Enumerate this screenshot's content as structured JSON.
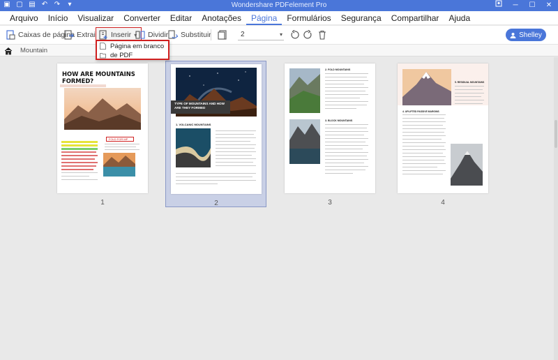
{
  "app": {
    "title": "Wondershare PDFelement Pro",
    "accent": "#4a76d9",
    "highlight": "#d02020"
  },
  "quick_access": [
    {
      "icon": "folder-icon",
      "glyph": "▣"
    },
    {
      "icon": "save-icon",
      "glyph": "▢"
    },
    {
      "icon": "print-icon",
      "glyph": "▤"
    },
    {
      "icon": "undo-icon",
      "glyph": "↶"
    },
    {
      "icon": "redo-icon",
      "glyph": "↷"
    },
    {
      "icon": "dropdown-icon",
      "glyph": "▾"
    }
  ],
  "menu": [
    {
      "label": "Arquivo",
      "active": false
    },
    {
      "label": "Início",
      "active": false
    },
    {
      "label": "Visualizar",
      "active": false
    },
    {
      "label": "Converter",
      "active": false
    },
    {
      "label": "Editar",
      "active": false
    },
    {
      "label": "Anotações",
      "active": false
    },
    {
      "label": "Página",
      "active": true
    },
    {
      "label": "Formulários",
      "active": false
    },
    {
      "label": "Segurança",
      "active": false
    },
    {
      "label": "Compartilhar",
      "active": false
    },
    {
      "label": "Ajuda",
      "active": false
    }
  ],
  "toolbar": {
    "page_boxes": "Caixas de página",
    "extract": "Extrair",
    "insert": "Inserir",
    "split": "Dividir",
    "replace": "Substituir",
    "page_value": "2"
  },
  "user": {
    "name": "Shelley"
  },
  "breadcrumb": {
    "label": "Mountain"
  },
  "insert_menu": {
    "blank_page": "Página em branco",
    "from_pdf": "de PDF"
  },
  "pages": [
    {
      "number": "1",
      "title": "HOW ARE MOUNTAINS FORMED?",
      "callout": "FOLD FOR MP"
    },
    {
      "number": "2",
      "title": "TYPE OF MOUNTAINS AND HOW ARE THEY FORMED",
      "section": "1. VOLCANIC MOUNTAINS",
      "selected": true
    },
    {
      "number": "3",
      "section1": "2. FOLD MOUNTAINS",
      "section2": "3. BLOCK MOUNTAINS"
    },
    {
      "number": "4",
      "section1": "5. RESIDUAL MOUNTAINS",
      "section2": "4. UPLIFTED PASSIVE MARGINS"
    }
  ]
}
